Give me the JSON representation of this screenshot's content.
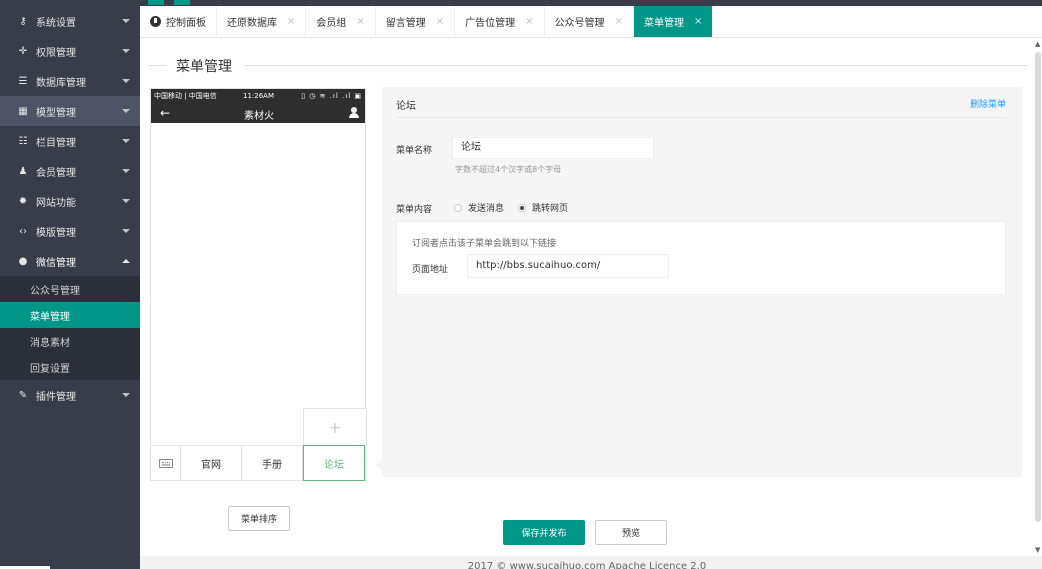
{
  "sidebar": {
    "items": [
      {
        "icon": "key-icon",
        "glyph": "⚷",
        "label": "系统设置"
      },
      {
        "icon": "globe-icon",
        "glyph": "✛",
        "label": "权限管理"
      },
      {
        "icon": "database-icon",
        "glyph": "☰",
        "label": "数据库管理"
      },
      {
        "icon": "model-icon",
        "glyph": "▦",
        "label": "模型管理"
      },
      {
        "icon": "list-icon",
        "glyph": "☷",
        "label": "栏目管理"
      },
      {
        "icon": "user-icon",
        "glyph": "♟",
        "label": "会员管理"
      },
      {
        "icon": "gear-icon",
        "glyph": "✹",
        "label": "网站功能"
      },
      {
        "icon": "code-icon",
        "glyph": "‹›",
        "label": "模版管理"
      },
      {
        "icon": "wechat-icon",
        "glyph": "●",
        "label": "微信管理"
      }
    ],
    "wechat_sub": [
      "公众号管理",
      "菜单管理",
      "消息素材",
      "回复设置"
    ],
    "plugin": {
      "icon": "wrench-icon",
      "glyph": "✎",
      "label": "插件管理"
    }
  },
  "tabs": [
    {
      "label": "控制面板",
      "closable": false
    },
    {
      "label": "还原数据库",
      "closable": true
    },
    {
      "label": "会员组",
      "closable": true
    },
    {
      "label": "留言管理",
      "closable": true
    },
    {
      "label": "广告位管理",
      "closable": true
    },
    {
      "label": "公众号管理",
      "closable": true
    },
    {
      "label": "菜单管理",
      "closable": true,
      "active": true
    }
  ],
  "tab_close_glyph": "×",
  "page_title": "菜单管理",
  "phone": {
    "carrier": "中国移动 | 中国电信",
    "time": "11:26AM",
    "status_icons": "▯ ◷ ≋ .ıl .ıl ▣",
    "back": "←",
    "title": "素材火",
    "plus": "+",
    "menu_items": [
      "官网",
      "手册",
      "论坛"
    ],
    "active_menu": "论坛"
  },
  "editor": {
    "title": "论坛",
    "delete_label": "删除菜单",
    "name_label": "菜单名称",
    "name_value": "论坛",
    "name_hint": "字数不超过4个汉字或8个字母",
    "content_label": "菜单内容",
    "options": [
      "发送消息",
      "跳转网页"
    ],
    "selected_option": "跳转网页",
    "link_note": "订阅者点击该子菜单会跳到以下链接",
    "url_label": "页面地址",
    "url_value": "http://bbs.sucaihuo.com/"
  },
  "buttons": {
    "sort": "菜单排序",
    "save": "保存并发布",
    "preview": "预览"
  },
  "footer": "2017 © www.sucaihuo.com Apache Licence 2.0",
  "colors": {
    "accent": "#009688",
    "sidebar": "#393d49",
    "active_menu": "#5fb878",
    "link": "#1e9fff"
  }
}
